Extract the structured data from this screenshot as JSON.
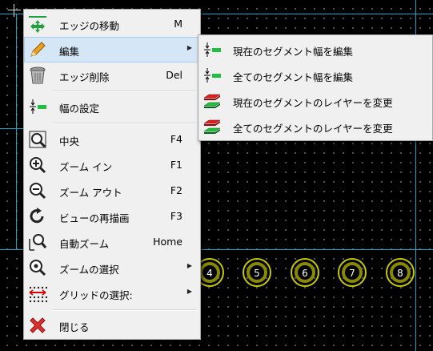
{
  "menu": {
    "items": [
      {
        "label": "エッジの移動",
        "shortcut": "M",
        "icon": "move-icon"
      },
      {
        "label": "編集",
        "shortcut": "",
        "icon": "pencil-icon",
        "submenu": true
      },
      {
        "label": "エッジ削除",
        "shortcut": "Del",
        "icon": "trash-icon"
      },
      {
        "label": "幅の設定",
        "shortcut": "",
        "icon": "width-icon"
      },
      {
        "label": "中央",
        "shortcut": "F4",
        "icon": "zoom-center-icon"
      },
      {
        "label": "ズーム イン",
        "shortcut": "F1",
        "icon": "zoom-in-icon"
      },
      {
        "label": "ズーム アウト",
        "shortcut": "F2",
        "icon": "zoom-out-icon"
      },
      {
        "label": "ビューの再描画",
        "shortcut": "F3",
        "icon": "redraw-icon"
      },
      {
        "label": "自動ズーム",
        "shortcut": "Home",
        "icon": "zoom-auto-icon"
      },
      {
        "label": "ズームの選択",
        "shortcut": "",
        "icon": "zoom-select-icon",
        "submenu": true
      },
      {
        "label": "グリッドの選択:",
        "shortcut": "",
        "icon": "grid-icon",
        "submenu": true
      },
      {
        "label": "閉じる",
        "shortcut": "",
        "icon": "close-icon"
      }
    ]
  },
  "submenu": {
    "items": [
      {
        "label": "現在のセグメント幅を編集",
        "icon": "width-icon"
      },
      {
        "label": "全てのセグメント幅を編集",
        "icon": "width-icon"
      },
      {
        "label": "現在のセグメントのレイヤーを変更",
        "icon": "layer-swap-icon"
      },
      {
        "label": "全てのセグメントのレイヤーを変更",
        "icon": "layer-swap-icon"
      }
    ]
  },
  "pads": [
    "4",
    "5",
    "6",
    "7",
    "8"
  ],
  "colors": {
    "pad": "#c8c800",
    "guide": "#1aa3c6",
    "hover": "#d5e6f7"
  }
}
